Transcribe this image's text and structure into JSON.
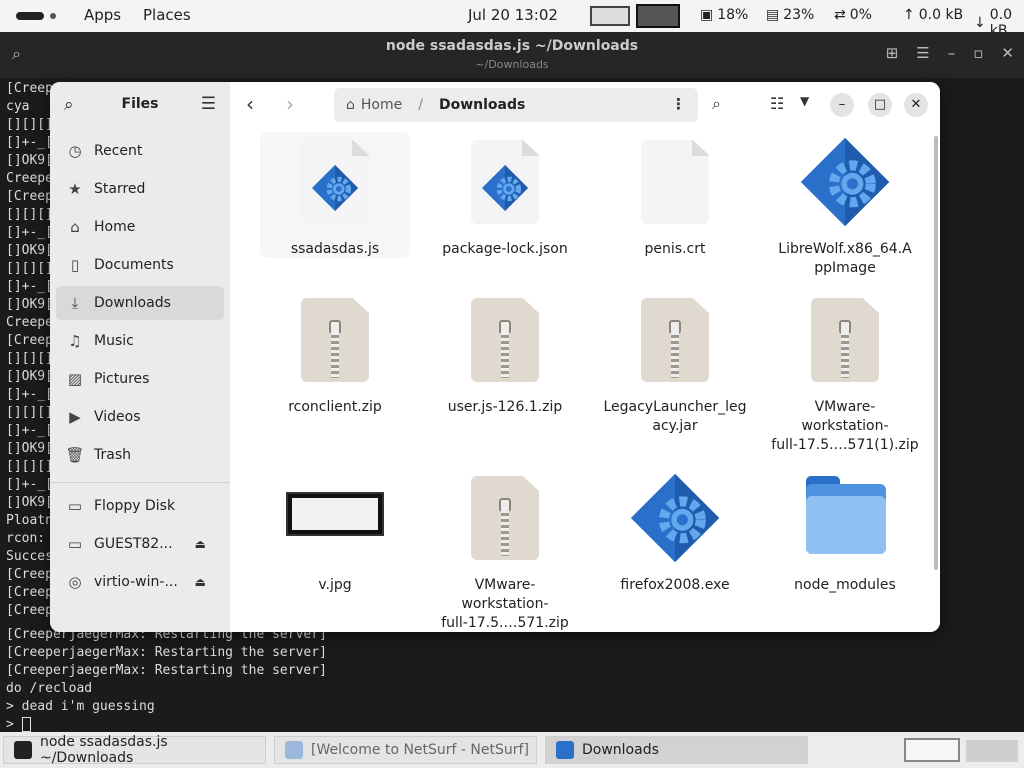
{
  "top_panel": {
    "apps": "Apps",
    "places": "Places",
    "clock": "Jul 20  13:02",
    "cpu": "18%",
    "memory": "23%",
    "swap": "0%",
    "upload": "0.0 kB",
    "download": "0.0 kB"
  },
  "terminal": {
    "title": "node ssadasdas.js ~/Downloads",
    "subtitle": "~/Downloads",
    "lines": [
      "[Creep",
      "cya",
      "[][][]",
      "[]+-_[",
      "[]OK9[",
      "Creepe",
      "[Creep",
      "[][][]",
      "[]+-_[",
      "[]OK9[",
      "[][][]",
      "[]+-_[",
      "[]OK9[",
      "Creepe",
      "[Creep",
      "[][][]",
      "[]OK9[",
      "[]+-_[",
      "[][][]",
      "[]+-_[",
      "[]OK9[",
      "[][][]",
      "[]+-_[",
      "[]OK9[",
      "Ploatn",
      "rcon: ",
      "Succes",
      "[Creep",
      "[Creep",
      "[Creep"
    ],
    "bottom_lines": [
      "[CreeperjaegerMax: Restarting the server]",
      "[CreeperjaegerMax: Restarting the server]",
      "[CreeperjaegerMax: Restarting the server]",
      "do /recload",
      "> dead i'm guessing",
      "> "
    ]
  },
  "files": {
    "sidebar_title": "Files",
    "sidebar": [
      {
        "label": "Recent",
        "icon": "clock-icon"
      },
      {
        "label": "Starred",
        "icon": "star-icon"
      },
      {
        "label": "Home",
        "icon": "home-icon"
      },
      {
        "label": "Documents",
        "icon": "document-icon"
      },
      {
        "label": "Downloads",
        "icon": "download-icon"
      },
      {
        "label": "Music",
        "icon": "music-icon"
      },
      {
        "label": "Pictures",
        "icon": "picture-icon"
      },
      {
        "label": "Videos",
        "icon": "video-icon"
      },
      {
        "label": "Trash",
        "icon": "trash-icon"
      }
    ],
    "devices": [
      {
        "label": "Floppy Disk",
        "icon": "floppy-icon"
      },
      {
        "label": "GUEST82...",
        "icon": "drive-icon"
      },
      {
        "label": "virtio-win-...",
        "icon": "disc-icon"
      }
    ],
    "path": {
      "home": "Home",
      "current": "Downloads"
    },
    "items": [
      {
        "name": "ssadasdas.js",
        "type": "script"
      },
      {
        "name": "package-lock.json",
        "type": "script"
      },
      {
        "name": "penis.crt",
        "type": "blank"
      },
      {
        "name": "LibreWolf.x86_64.A|ppImage",
        "type": "exec"
      },
      {
        "name": "rconclient.zip",
        "type": "zip"
      },
      {
        "name": "user.js-126.1.zip",
        "type": "zip"
      },
      {
        "name": "LegacyLauncher_leg|acy.jar",
        "type": "zip"
      },
      {
        "name": "VMware-|workstation-|full-17.5.…571(1).zip",
        "type": "zip"
      },
      {
        "name": "v.jpg",
        "type": "image"
      },
      {
        "name": "VMware-|workstation-|full-17.5.…571.zip",
        "type": "zip"
      },
      {
        "name": "firefox2008.exe",
        "type": "exec"
      },
      {
        "name": "node_modules",
        "type": "folder"
      }
    ]
  },
  "taskbar": [
    {
      "label": "node ssadasdas.js ~/Downloads"
    },
    {
      "label": "[Welcome to NetSurf - NetSurf]"
    },
    {
      "label": "Downloads"
    }
  ],
  "colors": {
    "accent_blue": "#2a6fc9",
    "gear_light": "#63a7ee",
    "folder": "#8ec0f2"
  }
}
